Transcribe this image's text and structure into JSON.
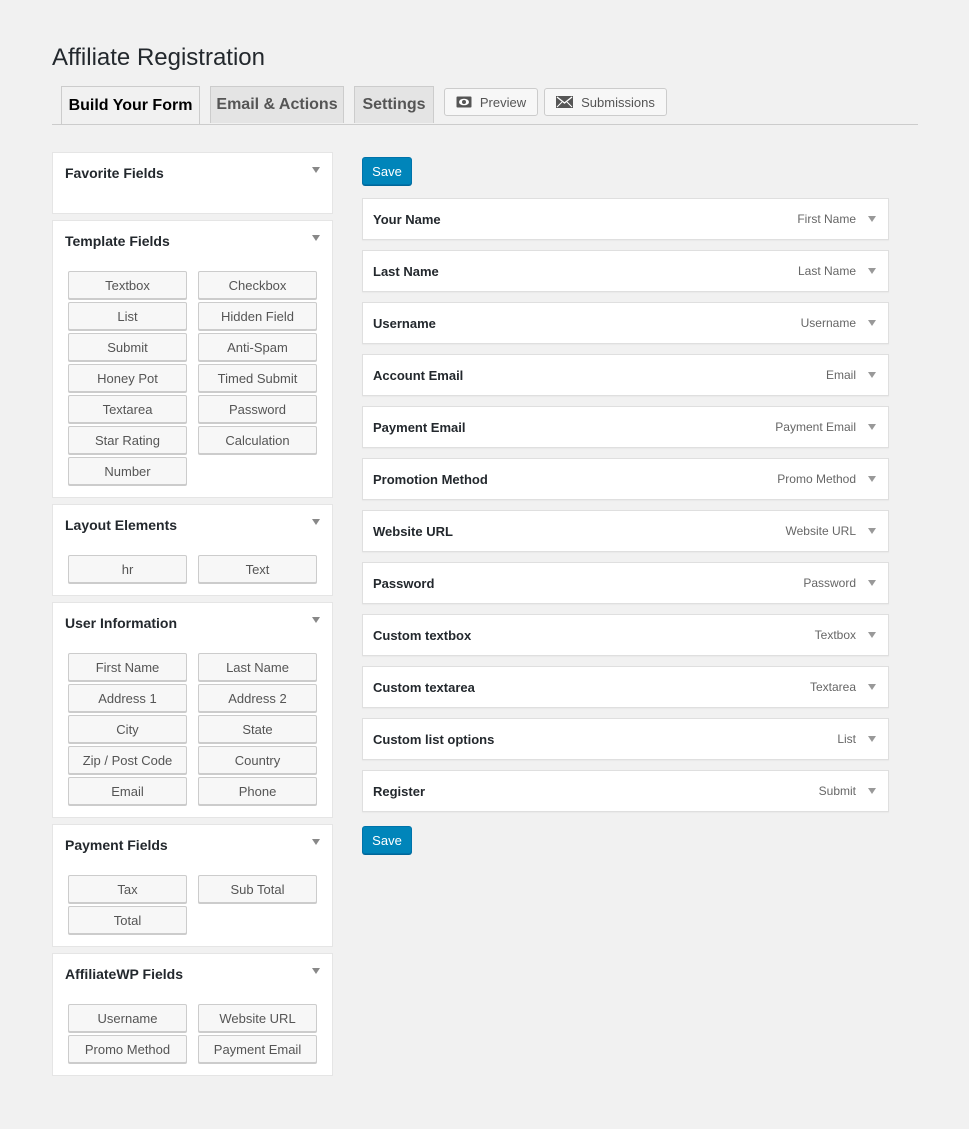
{
  "page": {
    "title": "Affiliate Registration"
  },
  "tabs": {
    "build": "Build Your Form",
    "email": "Email & Actions",
    "settings": "Settings",
    "preview": "Preview",
    "submissions": "Submissions"
  },
  "sidebar": {
    "favorite": {
      "title": "Favorite Fields"
    },
    "template": {
      "title": "Template Fields",
      "items": [
        "Textbox",
        "Checkbox",
        "List",
        "Hidden Field",
        "Submit",
        "Anti-Spam",
        "Honey Pot",
        "Timed Submit",
        "Textarea",
        "Password",
        "Star Rating",
        "Calculation",
        "Number"
      ]
    },
    "layout": {
      "title": "Layout Elements",
      "items": [
        "hr",
        "Text"
      ]
    },
    "user": {
      "title": "User Information",
      "items": [
        "First Name",
        "Last Name",
        "Address 1",
        "Address 2",
        "City",
        "State",
        "Zip / Post Code",
        "Country",
        "Email",
        "Phone"
      ]
    },
    "payment": {
      "title": "Payment Fields",
      "items": [
        "Tax",
        "Sub Total",
        "Total"
      ]
    },
    "affiliatewp": {
      "title": "AffiliateWP Fields",
      "items": [
        "Username",
        "Website URL",
        "Promo Method",
        "Payment Email"
      ]
    }
  },
  "main": {
    "save_label": "Save",
    "fields": [
      {
        "label": "Your Name",
        "type": "First Name"
      },
      {
        "label": "Last Name",
        "type": "Last Name"
      },
      {
        "label": "Username",
        "type": "Username"
      },
      {
        "label": "Account Email",
        "type": "Email"
      },
      {
        "label": "Payment Email",
        "type": "Payment Email"
      },
      {
        "label": "Promotion Method",
        "type": "Promo Method"
      },
      {
        "label": "Website URL",
        "type": "Website URL"
      },
      {
        "label": "Password",
        "type": "Password"
      },
      {
        "label": "Custom textbox",
        "type": "Textbox"
      },
      {
        "label": "Custom textarea",
        "type": "Textarea"
      },
      {
        "label": "Custom list options",
        "type": "List"
      },
      {
        "label": "Register",
        "type": "Submit"
      }
    ]
  },
  "colors": {
    "accent": "#0085ba",
    "background": "#f1f1f1"
  }
}
